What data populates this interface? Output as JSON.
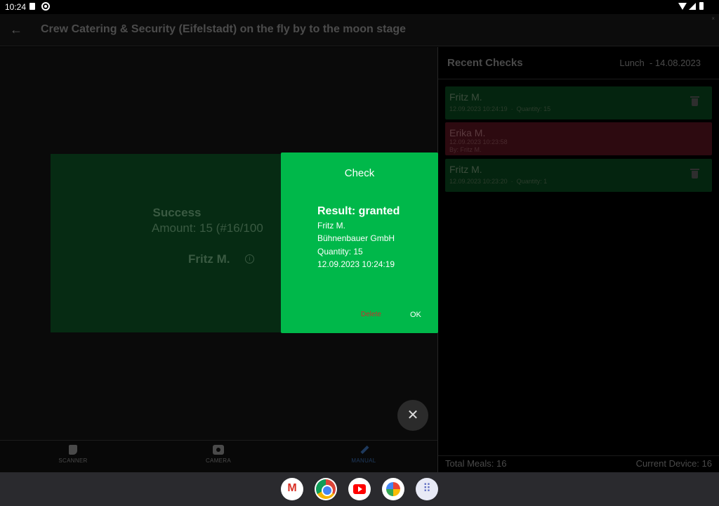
{
  "status_bar": {
    "time": "10:24"
  },
  "app_bar": {
    "title": "Crew Catering & Security (Eifelstadt) on the fly by to the moon stage"
  },
  "result_card": {
    "status": "Success",
    "amount": "Amount: 15 (#16/100",
    "person": "Fritz M."
  },
  "bottom_nav": {
    "items": [
      {
        "label": "SCANNER"
      },
      {
        "label": "CAMERA"
      },
      {
        "label": "MANUAL"
      }
    ]
  },
  "recent_checks": {
    "title": "Recent Checks",
    "meal": "Lunch  - 14.08.2023",
    "items": [
      {
        "name": "Fritz M.",
        "meta": "12.09.2023 10:24:19  ·  Quantity: 15",
        "state": "granted"
      },
      {
        "name": "Erika M.",
        "meta": "12.09.2023 10:23:58",
        "by": "By: Fritz M.",
        "state": "denied"
      },
      {
        "name": "Fritz M.",
        "meta": "12.09.2023 10:23:20  ·  Quantity: 1",
        "state": "granted"
      }
    ],
    "total_meals": "Total Meals: 16",
    "current_device": "Current Device: 16"
  },
  "dialog": {
    "title": "Check",
    "result": "Result: granted",
    "name": "Fritz M.",
    "company": "Bühnenbauer GmbH",
    "quantity": "Quantity: 15",
    "timestamp": "12.09.2023 10:24:19",
    "delete_label": "Delete",
    "ok_label": "OK"
  },
  "taskbar": {
    "apps": [
      "gmail-icon",
      "chrome-icon",
      "youtube-icon",
      "photos-icon",
      "app-drawer-icon"
    ]
  },
  "colors": {
    "dialog_bg": "#00b84a",
    "delete_text": "#c9302c",
    "granted_item": "#04240f",
    "denied_item": "#2d0a10"
  }
}
